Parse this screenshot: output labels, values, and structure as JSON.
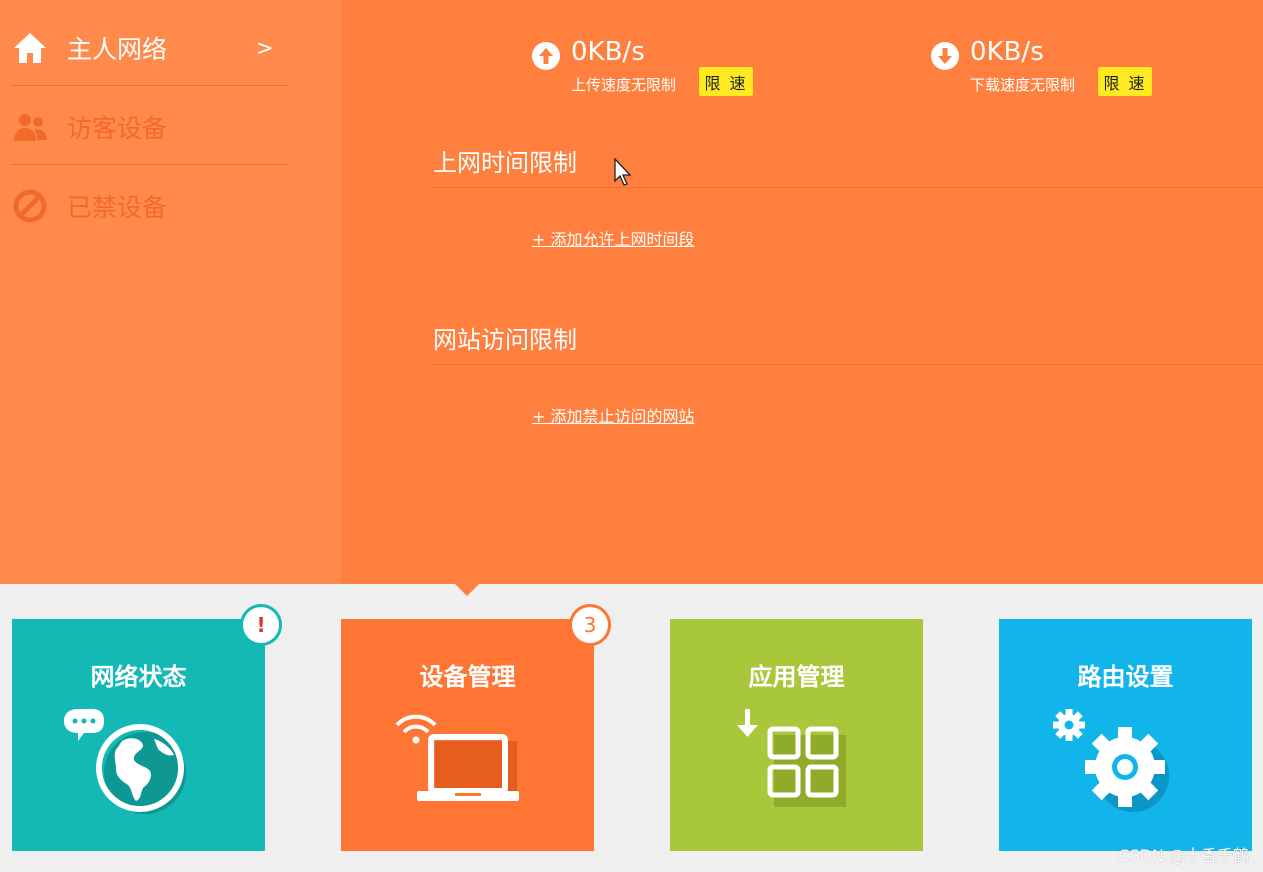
{
  "sidebar": {
    "items": [
      {
        "label": "主人网络",
        "icon": "home-icon",
        "active": true,
        "chevron": ">"
      },
      {
        "label": "访客设备",
        "icon": "guests-icon",
        "active": false
      },
      {
        "label": "已禁设备",
        "icon": "blocked-icon",
        "active": false
      }
    ]
  },
  "speed": {
    "upload": {
      "value": "0KB/s",
      "status": "上传速度无限制",
      "limit_button": "限 速"
    },
    "download": {
      "value": "0KB/s",
      "status": "下载速度无限制",
      "limit_button": "限 速"
    }
  },
  "sections": {
    "time_limit": {
      "title": "上网时间限制",
      "link": "+ 添加允许上网时间段"
    },
    "site_limit": {
      "title": "网站访问限制",
      "link": "+ 添加禁止访问的网站"
    }
  },
  "tiles": [
    {
      "label": "网络状态",
      "color": "#14b8b4",
      "icon": "globe-icon",
      "badge": "!"
    },
    {
      "label": "设备管理",
      "color": "#ff7533",
      "icon": "laptop-icon",
      "badge": "3"
    },
    {
      "label": "应用管理",
      "color": "#a9c73b",
      "icon": "apps-icon"
    },
    {
      "label": "路由设置",
      "color": "#11b5ea",
      "icon": "gear-icon"
    }
  ],
  "colors": {
    "header_orange": "#ff7f3f",
    "sidebar_orange": "#ff8a4c",
    "limit_yellow": "#ffea21",
    "inactive_text": "#f26a2a"
  },
  "watermark": "CSDN @十香千鹤"
}
